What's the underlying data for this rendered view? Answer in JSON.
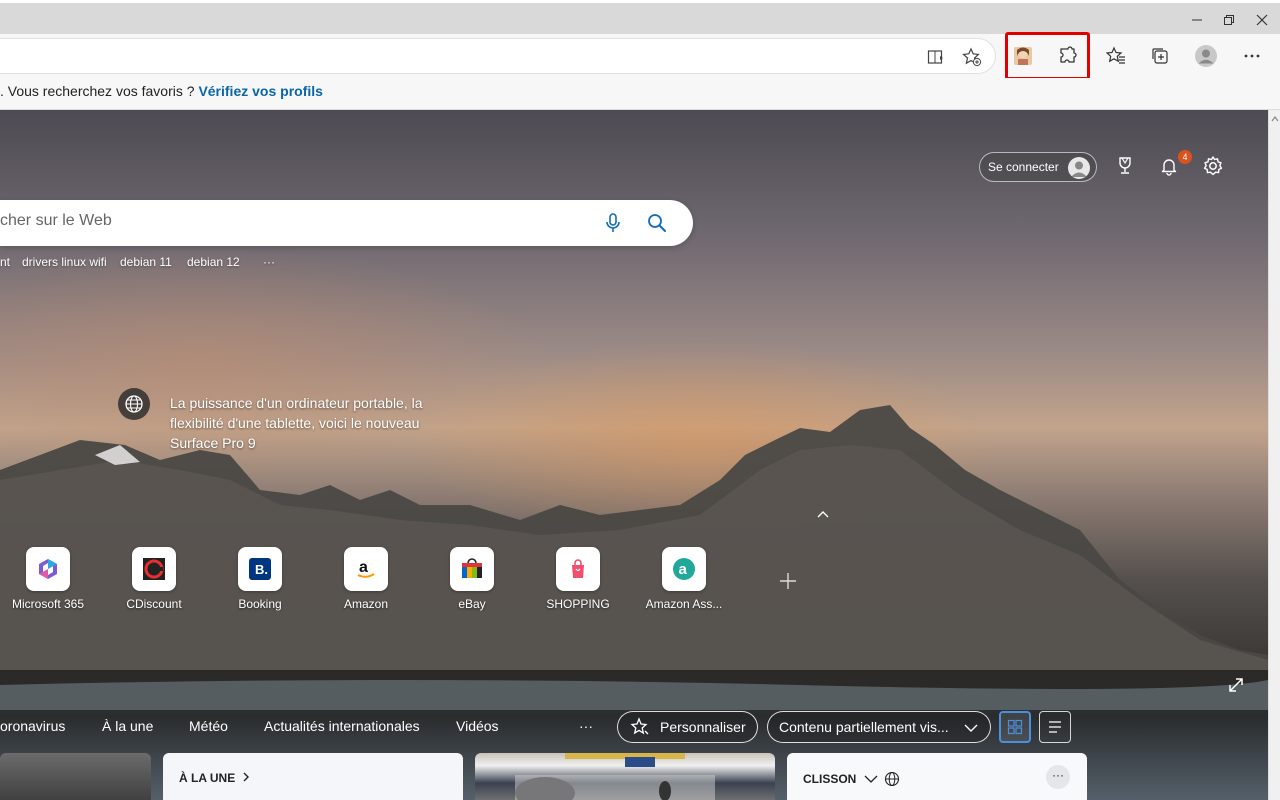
{
  "window": {
    "controls": [
      "minimize",
      "restore",
      "close"
    ]
  },
  "toolbar": {
    "icons": [
      "immersive-reader-icon",
      "add-favorite-icon",
      "profile-picture-icon",
      "extensions-icon",
      "favorites-icon",
      "collections-icon",
      "profile-icon",
      "more-icon"
    ],
    "highlight_color": "#e00000"
  },
  "favbar": {
    "text": ". Vous recherchez vos favoris ?",
    "link": "Vérifiez vos profils",
    "link_color": "#0a66a8"
  },
  "header": {
    "signin_label": "Se connecter",
    "notification_count": "4"
  },
  "search": {
    "placeholder": "cher sur le Web"
  },
  "trending": [
    "nt",
    "drivers linux wifi",
    "debian 11",
    "debian 12",
    "···"
  ],
  "promo": {
    "text": "La puissance d'un ordinateur portable, la flexibilité d'une tablette, voici le nouveau Surface Pro 9"
  },
  "quicklinks": [
    {
      "label": "Microsoft 365",
      "icon": "microsoft365-icon"
    },
    {
      "label": "CDiscount",
      "icon": "cdiscount-icon"
    },
    {
      "label": "Booking",
      "icon": "booking-icon"
    },
    {
      "label": "Amazon",
      "icon": "amazon-icon"
    },
    {
      "label": "eBay",
      "icon": "ebay-icon"
    },
    {
      "label": "SHOPPING",
      "icon": "shopping-icon"
    },
    {
      "label": "Amazon Ass...",
      "icon": "amazon-assistant-icon"
    }
  ],
  "feed_nav": {
    "items": [
      "oronavirus",
      "À la une",
      "Météo",
      "Actualités internationales",
      "Vidéos"
    ],
    "more": "···",
    "personalize": "Personnaliser",
    "content_select": "Contenu partiellement vis..."
  },
  "cards": {
    "headline_title": "À LA UNE",
    "weather_title": "CLISSON",
    "more": "···"
  }
}
